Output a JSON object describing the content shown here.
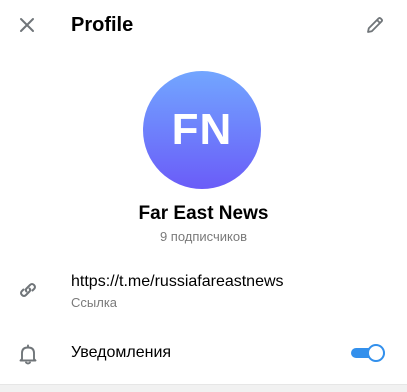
{
  "header": {
    "title": "Profile"
  },
  "profile": {
    "initials": "FN",
    "name": "Far East News",
    "subscribers": "9 подписчиков"
  },
  "link": {
    "url": "https://t.me/russiafareastnews",
    "caption": "Ссылка"
  },
  "notifications": {
    "label": "Уведомления",
    "enabled": true
  },
  "colors": {
    "accent": "#3390ec",
    "avatar_gradient_top": "#72a6ff",
    "avatar_gradient_bottom": "#6a5cf8",
    "secondary_text": "#7a7a7a"
  },
  "icons": {
    "close": "close-icon",
    "edit": "pencil-icon",
    "link": "link-icon",
    "notifications": "bell-icon"
  }
}
